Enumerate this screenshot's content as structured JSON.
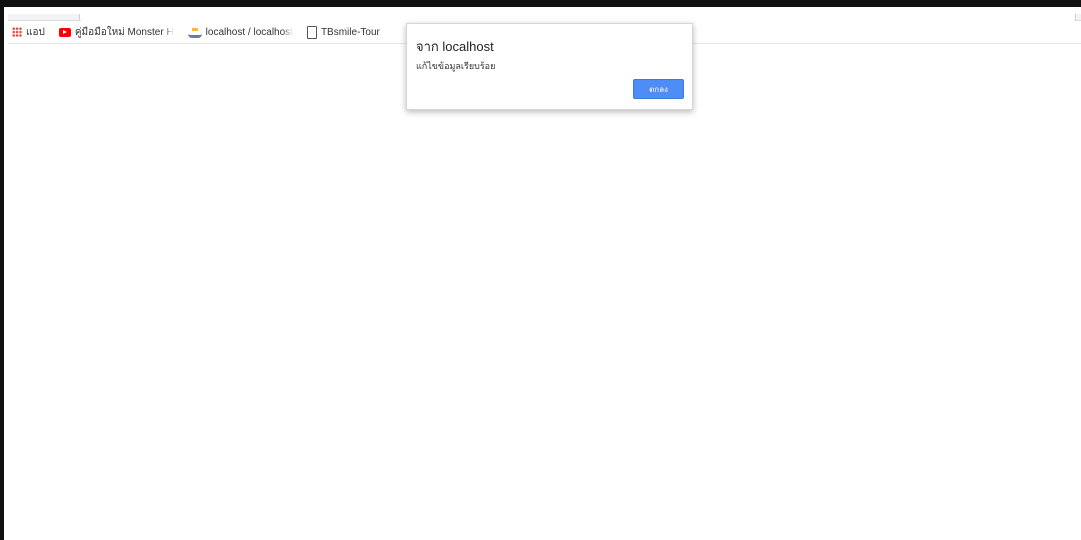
{
  "bookmarks_bar": {
    "items": [
      {
        "icon": "apps-grid-icon",
        "label": "แอป"
      },
      {
        "icon": "youtube-icon",
        "label": "คู่มือมือใหม่ Monster H"
      },
      {
        "icon": "phpmyadmin-icon",
        "label": "localhost / localhost"
      },
      {
        "icon": "document-icon",
        "label": "TBsmile-Tour"
      }
    ]
  },
  "alert_dialog": {
    "title": "จาก localhost",
    "message": "แก้ไขข้อมูลเรียบร้อย",
    "ok_label": "ตกลง",
    "button_color": "#4d8df5"
  }
}
